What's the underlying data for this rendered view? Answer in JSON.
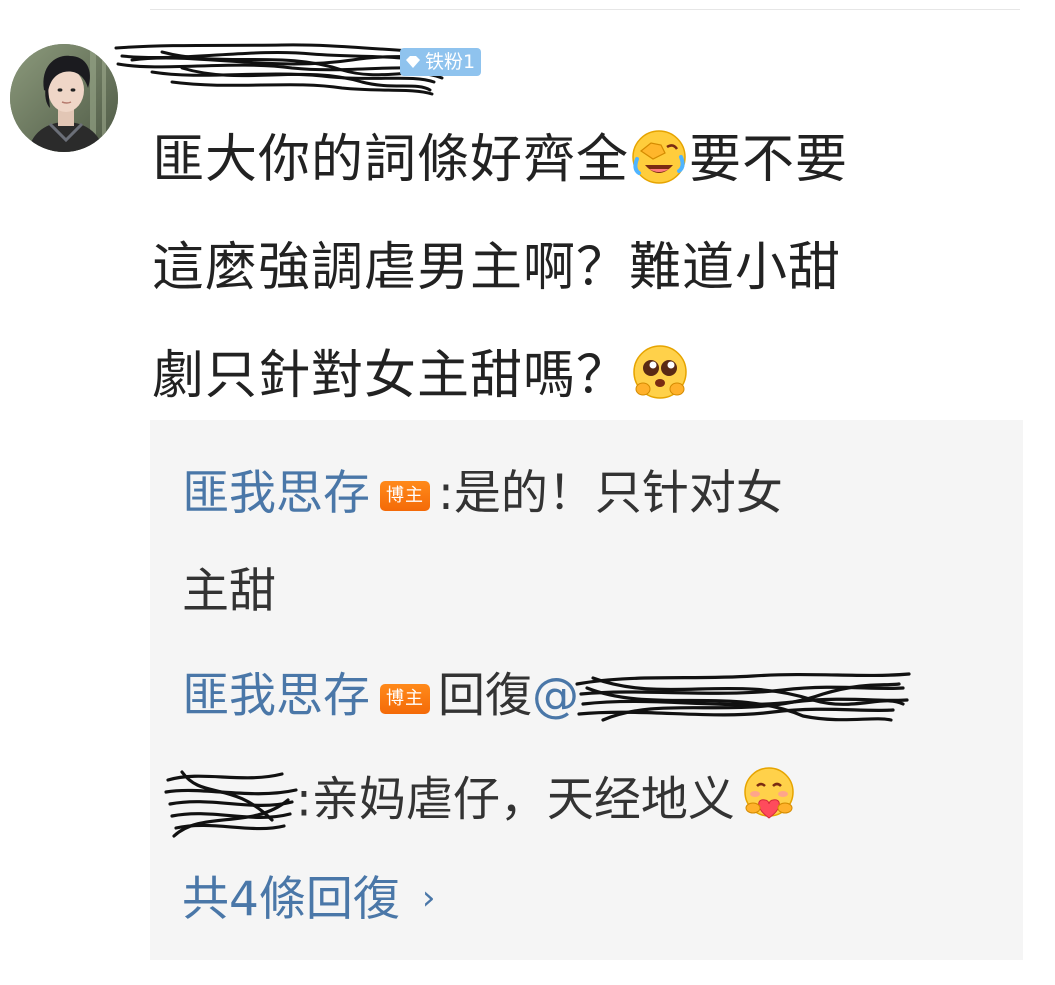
{
  "comment": {
    "fan_badge": "铁粉1",
    "body_lines": [
      [
        "匪大你的詞條好齊全",
        "要不要"
      ],
      [
        "這麼強調虐男主啊？難道小甜"
      ],
      [
        "劇只針對女主甜嗎？"
      ]
    ],
    "emojis": [
      "laugh-cry-facepalm",
      "pleading-face"
    ]
  },
  "replies": {
    "items": [
      {
        "author": "匪我思存",
        "badge": "博主",
        "sep": ":",
        "text_line1": "是的！只针对女",
        "text_line2": "主甜"
      },
      {
        "author": "匪我思存",
        "badge": "博主",
        "reply_word": "回復",
        "mention_prefix": "@",
        "sep": ":",
        "text": "亲妈虐仔，天经地义",
        "emoji": "hugging-heart-face"
      }
    ],
    "view_all": "共4條回復",
    "view_all_chevron": "›"
  },
  "colors": {
    "author_blue": "#4a77a8",
    "badge_orange": "#f46a08",
    "fan_badge_blue": "#8fc3ee",
    "reply_bg": "#f5f5f5",
    "text": "#222222"
  }
}
